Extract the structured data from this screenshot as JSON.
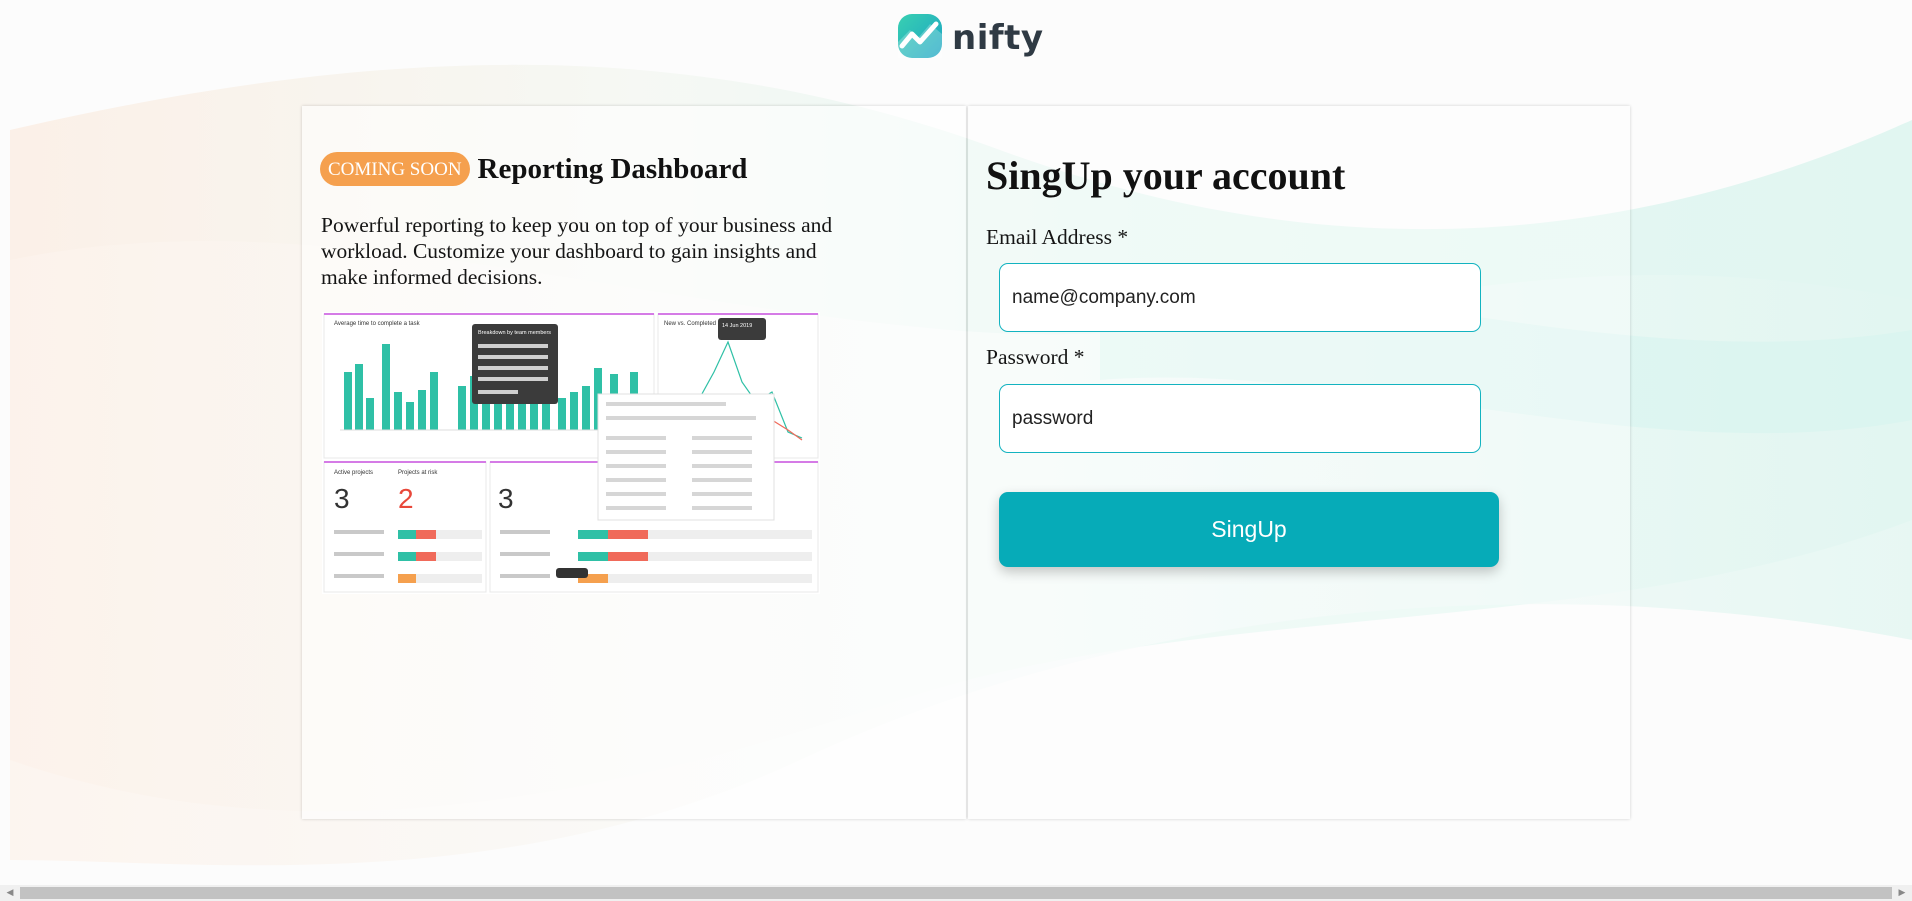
{
  "brand": {
    "name": "nifty",
    "logo_icon": "nifty-logo-icon",
    "accent": "#06abb8"
  },
  "feature": {
    "badge": "COMING SOON",
    "title": "Reporting Dashboard",
    "description": "Powerful reporting to keep you on top of your business and workload. Customize your dashboard to gain insights and make informed decisions.",
    "badge_color": "#f5a04e",
    "preview": {
      "chart_title": "Average time to complete a task",
      "chart2_title": "New vs. Completed",
      "tooltip_title": "Breakdown by team members",
      "tooltip2_title": "14 Jun 2019",
      "card_active_projects": "Active projects",
      "card_projects_at_risk": "Projects at risk",
      "active_value": "3",
      "risk_value": "2"
    }
  },
  "signup": {
    "title": "SingUp your account",
    "email_label": "Email Address *",
    "email_placeholder": "name@company.com",
    "password_label": "Password *",
    "password_placeholder": "password",
    "button_label": "SingUp"
  }
}
